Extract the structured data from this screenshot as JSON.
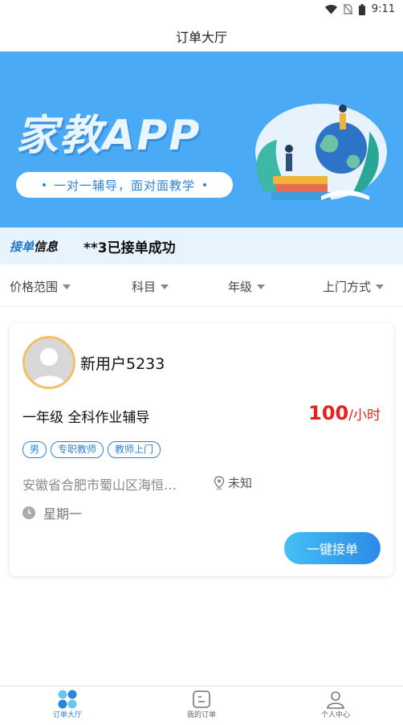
{
  "status_bar": {
    "time": "9:11",
    "icons": [
      "wifi-icon",
      "no-sim-icon",
      "battery-icon"
    ]
  },
  "header": {
    "title": "订单大厅"
  },
  "banner": {
    "title": "家教APP",
    "slogan": "一对一辅导，面对面教学"
  },
  "ticker": {
    "tag_part1": "接单",
    "tag_part2": "信息",
    "message": "**3已接单成功"
  },
  "filters": [
    {
      "label": "价格范围"
    },
    {
      "label": "科目"
    },
    {
      "label": "年级"
    },
    {
      "label": "上门方式"
    }
  ],
  "order": {
    "username": "新用户5233",
    "subject": "一年级 全科作业辅导",
    "price": "100",
    "price_unit": "/小时",
    "tags": [
      "男",
      "专职教师",
      "教师上门"
    ],
    "address": "安徽省合肥市蜀山区海恒…",
    "distance": "未知",
    "schedule": "星期一",
    "action_label": "一键接单"
  },
  "tabbar": {
    "items": [
      {
        "label": "订单大厅",
        "icon": "grid-icon",
        "active": true
      },
      {
        "label": "我的订单",
        "icon": "order-icon",
        "active": false
      },
      {
        "label": "个人中心",
        "icon": "person-icon",
        "active": false
      }
    ]
  },
  "colors": {
    "accent": "#2c84d8",
    "banner": "#4aaaf5",
    "price": "#e8211d"
  }
}
